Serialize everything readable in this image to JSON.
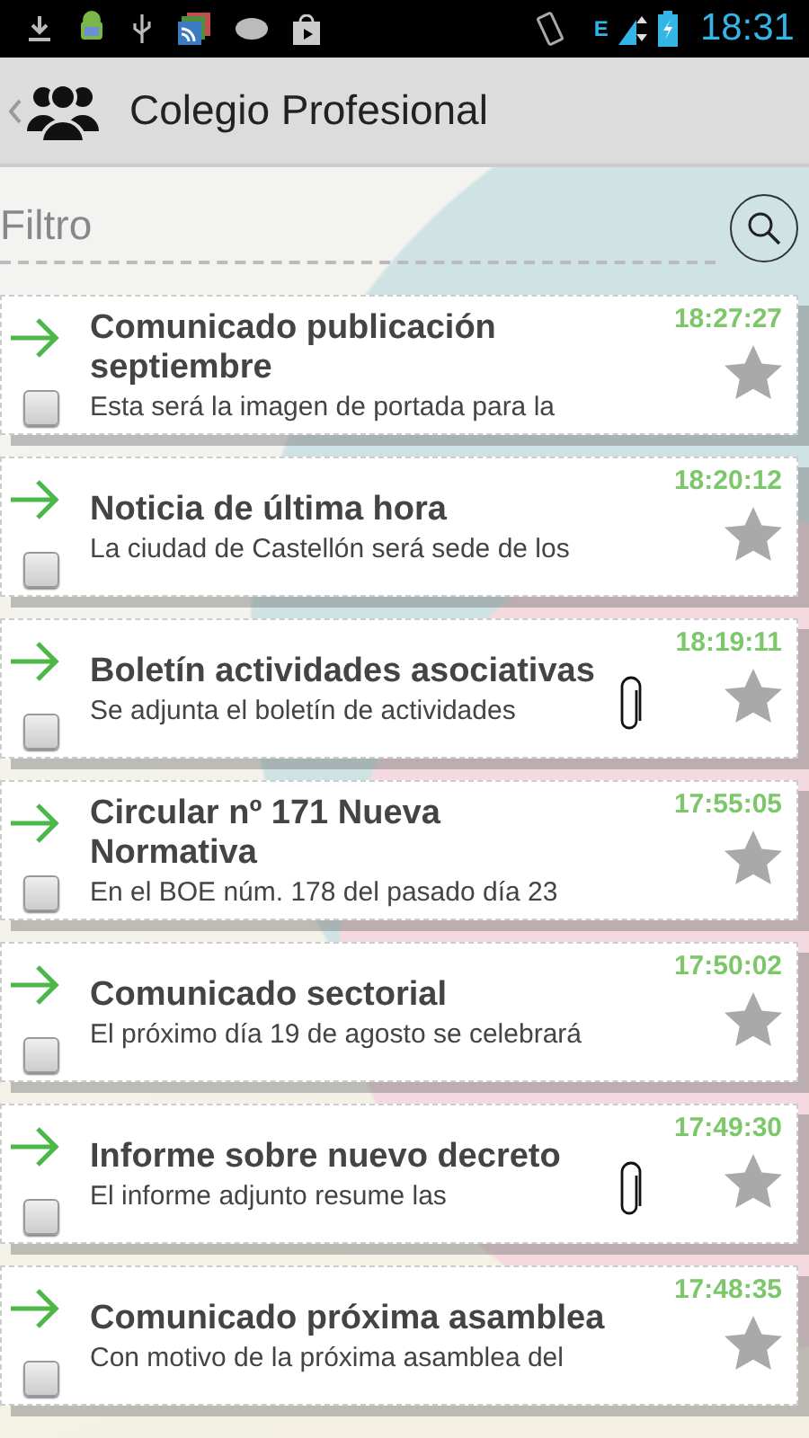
{
  "status_bar": {
    "time": "18:31",
    "network": "E"
  },
  "action_bar": {
    "title": "Colegio Profesional"
  },
  "filter": {
    "placeholder": "Filtro"
  },
  "items": [
    {
      "title": "Comunicado publicación septiembre",
      "summary": "Esta será la imagen de portada para la",
      "time": "18:27:27",
      "attachment": false,
      "checked": false,
      "starred": false
    },
    {
      "title": "Noticia de última hora",
      "summary": "La ciudad de Castellón será sede de los",
      "time": "18:20:12",
      "attachment": false,
      "checked": false,
      "starred": false
    },
    {
      "title": "Boletín actividades asociativas",
      "summary": "Se adjunta el boletín de actividades",
      "time": "18:19:11",
      "attachment": true,
      "checked": false,
      "starred": false
    },
    {
      "title": "Circular nº 171 Nueva Normativa",
      "summary": "En el BOE núm. 178 del pasado día 23",
      "time": "17:55:05",
      "attachment": false,
      "checked": false,
      "starred": false
    },
    {
      "title": "Comunicado sectorial",
      "summary": "El próximo día 19 de agosto se celebrará",
      "time": "17:50:02",
      "attachment": false,
      "checked": false,
      "starred": false
    },
    {
      "title": "Informe sobre nuevo decreto",
      "summary": "El informe adjunto resume las",
      "time": "17:49:30",
      "attachment": true,
      "checked": false,
      "starred": false
    },
    {
      "title": "Comunicado próxima asamblea",
      "summary": "Con motivo de la próxima asamblea del",
      "time": "17:48:35",
      "attachment": false,
      "checked": false,
      "starred": false
    }
  ]
}
